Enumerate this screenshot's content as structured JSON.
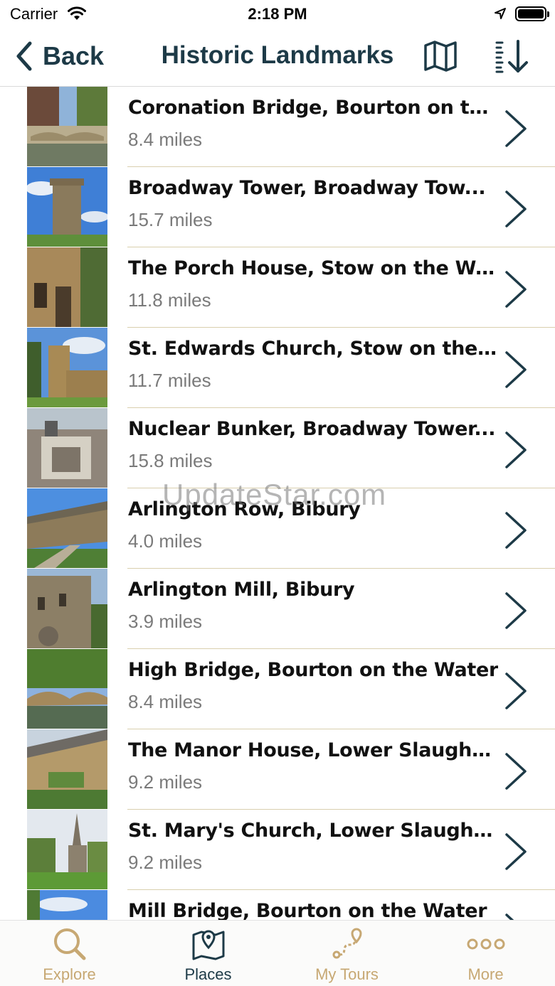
{
  "status_bar": {
    "carrier": "Carrier",
    "time": "2:18 PM"
  },
  "nav": {
    "back_label": "Back",
    "title": "Historic Landmarks",
    "map_icon": "map-icon",
    "sort_icon": "sort-descending-icon"
  },
  "colors": {
    "accent": "#c7a873",
    "primary": "#1d3a47",
    "divider": "#d9cfae"
  },
  "landmarks": [
    {
      "name": "Coronation Bridge, Bourton on th...",
      "distance": "8.4 miles"
    },
    {
      "name": "Broadway Tower, Broadway Tow...",
      "distance": "15.7 miles"
    },
    {
      "name": "The Porch House, Stow on the Wold",
      "distance": "11.8 miles"
    },
    {
      "name": "St. Edwards Church, Stow on the...",
      "distance": "11.7 miles"
    },
    {
      "name": "Nuclear Bunker, Broadway Tower...",
      "distance": "15.8 miles"
    },
    {
      "name": "Arlington Row, Bibury",
      "distance": "4.0 miles"
    },
    {
      "name": "Arlington Mill, Bibury",
      "distance": "3.9 miles"
    },
    {
      "name": "High Bridge, Bourton on the Water",
      "distance": "8.4 miles"
    },
    {
      "name": "The Manor House, Lower Slaughter",
      "distance": "9.2 miles"
    },
    {
      "name": "St. Mary's Church, Lower Slaughter",
      "distance": "9.2 miles"
    },
    {
      "name": "Mill Bridge, Bourton on the Water",
      "distance": ""
    }
  ],
  "watermark": "UpdateStar.com",
  "tabs": [
    {
      "label": "Explore",
      "icon": "search-icon",
      "active": false
    },
    {
      "label": "Places",
      "icon": "map-pin-icon",
      "active": true
    },
    {
      "label": "My Tours",
      "icon": "route-icon",
      "active": false
    },
    {
      "label": "More",
      "icon": "more-icon",
      "active": false
    }
  ]
}
